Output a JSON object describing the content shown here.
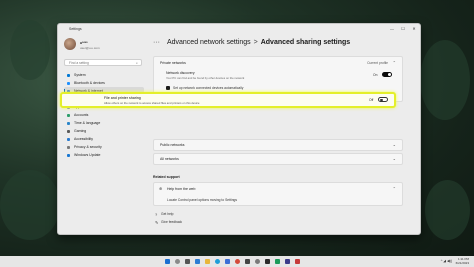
{
  "window": {
    "app_title": "Settings",
    "controls": [
      "—",
      "☐",
      "✕"
    ]
  },
  "user": {
    "name": "u****",
    "email": "user@••••.com"
  },
  "search": {
    "placeholder": "Find a setting"
  },
  "sidebar": {
    "items": [
      {
        "label": "System",
        "color": "#0078d4"
      },
      {
        "label": "Bluetooth & devices",
        "color": "#1e90ff"
      },
      {
        "label": "Network & internet",
        "color": "#3a7bd5",
        "active": true
      },
      {
        "label": "Personalization",
        "color": "#d9822b"
      },
      {
        "label": "Apps",
        "color": "#6b6bd6"
      },
      {
        "label": "Accounts",
        "color": "#2e9e6b"
      },
      {
        "label": "Time & language",
        "color": "#2a85c9"
      },
      {
        "label": "Gaming",
        "color": "#5a5a5a"
      },
      {
        "label": "Accessibility",
        "color": "#2a7bd0"
      },
      {
        "label": "Privacy & security",
        "color": "#7a7a7a"
      },
      {
        "label": "Windows Update",
        "color": "#1877d2"
      }
    ]
  },
  "breadcrumb": {
    "dots": "···",
    "sep": ">",
    "parent": "Advanced network settings",
    "current": "Advanced sharing settings"
  },
  "private_networks": {
    "title": "Private networks",
    "profile_label": "Current profile",
    "network_discovery": {
      "title": "Network discovery",
      "desc": "Your PC can find and be found by other devices on the network",
      "state": "On"
    },
    "auto_setup": {
      "label": "Set up network connected devices automatically"
    },
    "file_printer": {
      "title": "File and printer sharing",
      "desc": "Allow others on the network to access shared files and printers on this device",
      "state": "Off"
    }
  },
  "public_networks": {
    "title": "Public networks"
  },
  "all_networks": {
    "title": "All networks"
  },
  "related": {
    "heading": "Related support",
    "help_title": "Help from the web",
    "help_link": "Locate Control panel options moving to Settings"
  },
  "links": {
    "get_help": "Get help",
    "feedback": "Give feedback"
  },
  "taskbar": {
    "time": "1:11 PM",
    "date": "6/21/2023",
    "tray": "^  ◢ ◀))"
  }
}
